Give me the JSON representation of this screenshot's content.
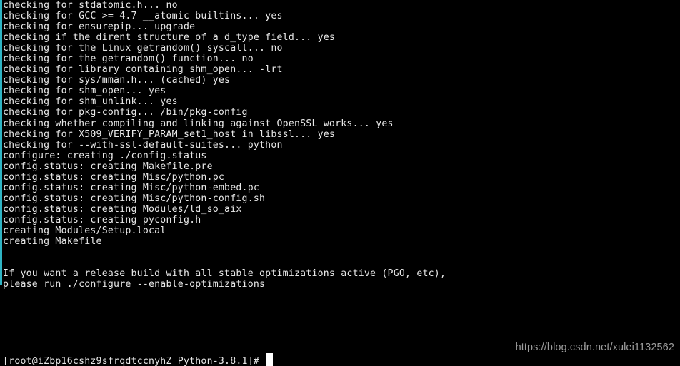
{
  "terminal": {
    "background_color": "#000000",
    "foreground_color": "#e8e8e8",
    "scrollbar_color": "#2fb4c4",
    "cursor_color": "#ffffff",
    "lines": [
      "checking for stdatomic.h... no",
      "checking for GCC >= 4.7 __atomic builtins... yes",
      "checking for ensurepip... upgrade",
      "checking if the dirent structure of a d_type field... yes",
      "checking for the Linux getrandom() syscall... no",
      "checking for the getrandom() function... no",
      "checking for library containing shm_open... -lrt",
      "checking for sys/mman.h... (cached) yes",
      "checking for shm_open... yes",
      "checking for shm_unlink... yes",
      "checking for pkg-config... /bin/pkg-config",
      "checking whether compiling and linking against OpenSSL works... yes",
      "checking for X509_VERIFY_PARAM_set1_host in libssl... yes",
      "checking for --with-ssl-default-suites... python",
      "configure: creating ./config.status",
      "config.status: creating Makefile.pre",
      "config.status: creating Misc/python.pc",
      "config.status: creating Misc/python-embed.pc",
      "config.status: creating Misc/python-config.sh",
      "config.status: creating Modules/ld_so_aix",
      "config.status: creating pyconfig.h",
      "creating Modules/Setup.local",
      "creating Makefile",
      "",
      "",
      "If you want a release build with all stable optimizations active (PGO, etc),",
      "please run ./configure --enable-optimizations",
      "",
      ""
    ],
    "prompt": "[root@iZbp16cshz9sfrqdtccnyhZ Python-3.8.1]# ",
    "cursor": "block-cursor"
  },
  "watermark": {
    "text": "https://blog.csdn.net/xulei1132562"
  }
}
